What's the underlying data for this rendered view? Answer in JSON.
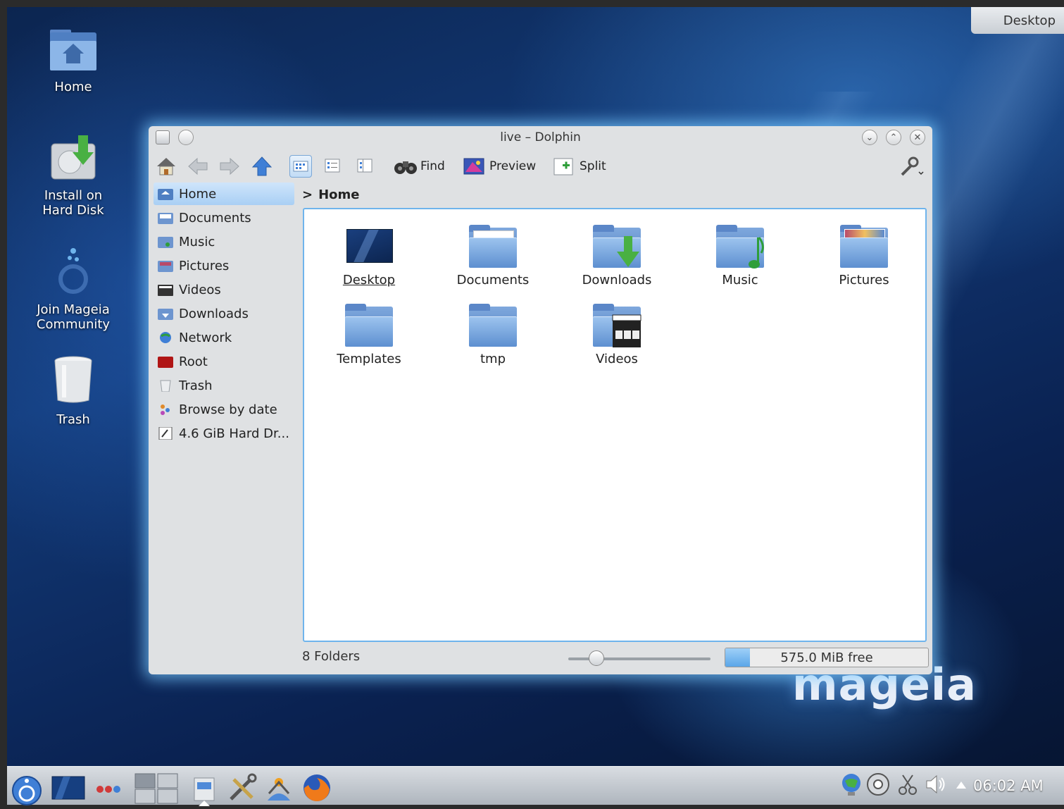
{
  "desktop": {
    "icons": [
      {
        "label": "Home",
        "icon": "home-folder-icon"
      },
      {
        "label": "Install on Hard Disk",
        "icon": "install-disk-icon"
      },
      {
        "label": "Join Mageia Community",
        "icon": "mageia-community-icon"
      },
      {
        "label": "Trash",
        "icon": "trash-icon"
      }
    ],
    "activity_label": "Desktop",
    "brand": "mageia"
  },
  "window": {
    "title": "live – Dolphin",
    "toolbar": {
      "find_label": "Find",
      "preview_label": "Preview",
      "split_label": "Split"
    },
    "places": [
      {
        "label": "Home",
        "icon": "home-icon",
        "selected": true
      },
      {
        "label": "Documents",
        "icon": "documents-icon"
      },
      {
        "label": "Music",
        "icon": "music-icon"
      },
      {
        "label": "Pictures",
        "icon": "pictures-icon"
      },
      {
        "label": "Videos",
        "icon": "videos-icon"
      },
      {
        "label": "Downloads",
        "icon": "downloads-icon"
      },
      {
        "label": "Network",
        "icon": "network-icon"
      },
      {
        "label": "Root",
        "icon": "root-icon"
      },
      {
        "label": "Trash",
        "icon": "trash-icon"
      },
      {
        "label": "Browse by date",
        "icon": "calendar-icon"
      },
      {
        "label": "4.6 GiB Hard Dr...",
        "icon": "hard-drive-icon"
      }
    ],
    "breadcrumb": {
      "separator": ">",
      "current": "Home"
    },
    "files": [
      {
        "label": "Desktop",
        "icon": "desktop-folder-icon"
      },
      {
        "label": "Documents",
        "icon": "documents-folder-icon"
      },
      {
        "label": "Downloads",
        "icon": "downloads-folder-icon"
      },
      {
        "label": "Music",
        "icon": "music-folder-icon"
      },
      {
        "label": "Pictures",
        "icon": "pictures-folder-icon"
      },
      {
        "label": "Templates",
        "icon": "templates-folder-icon"
      },
      {
        "label": "tmp",
        "icon": "tmp-folder-icon"
      },
      {
        "label": "Videos",
        "icon": "videos-folder-icon"
      }
    ],
    "status": {
      "summary": "8 Folders",
      "free_space": "575.0 MiB free",
      "used_fraction": 0.12,
      "zoom_fraction": 0.2
    }
  },
  "taskbar": {
    "clock": "06:02 AM"
  },
  "colors": {
    "accent": "#6fb4ec",
    "selection": "#a9cff4",
    "folder": "#5d8fd0"
  }
}
